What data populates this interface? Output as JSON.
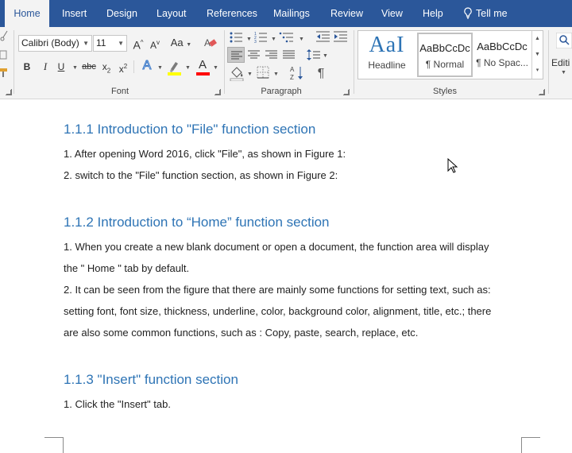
{
  "tabs": [
    {
      "label": "Home",
      "active": true
    },
    {
      "label": "Insert"
    },
    {
      "label": "Design"
    },
    {
      "label": "Layout"
    },
    {
      "label": "References"
    },
    {
      "label": "Mailings"
    },
    {
      "label": "Review"
    },
    {
      "label": "View"
    },
    {
      "label": "Help"
    },
    {
      "label": "Tell me",
      "icon": "lightbulb-icon"
    }
  ],
  "font_group": {
    "label": "Font",
    "font_name": "Calibri (Body)",
    "font_size": "11",
    "change_case": "Aa",
    "bold": "B",
    "italic": "I",
    "underline": "U",
    "strikethrough": "abc",
    "subscript": "x",
    "subscript_mark": "2",
    "superscript": "x",
    "superscript_mark": "2",
    "text_effects": "A",
    "font_color": "A",
    "grow_font": "A",
    "shrink_font": "A",
    "highlight_color": "#ffff00",
    "font_color_value": "#ff0000"
  },
  "paragraph_group": {
    "label": "Paragraph",
    "pilcrow": "¶"
  },
  "styles_group": {
    "label": "Styles",
    "styles": [
      {
        "preview": "AaI",
        "name": "Headline"
      },
      {
        "preview": "AaBbCcDc",
        "name": "¶ Normal",
        "selected": true
      },
      {
        "preview": "AaBbCcDc",
        "name": "¶ No Spac..."
      }
    ]
  },
  "editing_group": {
    "label": "Editi"
  },
  "document": {
    "blocks": [
      {
        "type": "heading",
        "text": "1.1.1 Introduction to \"File\" function section"
      },
      {
        "type": "para",
        "text": "1. After opening Word 2016, click \"File\", as shown in Figure 1:"
      },
      {
        "type": "para",
        "text": "2. switch to the \"File\" function section, as shown in Figure 2:"
      },
      {
        "type": "heading",
        "text": "1.1.2 Introduction to “Home” function section"
      },
      {
        "type": "para",
        "text": "1. When you create a new blank document or open a document, the function area will display"
      },
      {
        "type": "para",
        "text": "the \" Home \" tab by default."
      },
      {
        "type": "para",
        "text": "2. It can be seen from the figure that there are mainly some functions for setting text, such as:"
      },
      {
        "type": "para",
        "text": "setting font, font size, thickness, underline, color, background color, alignment, title, etc.; there"
      },
      {
        "type": "para",
        "text": "are also some common functions, such as : Copy, paste, search, replace, etc."
      },
      {
        "type": "heading",
        "text": "1.1.3 \"Insert\" function section"
      },
      {
        "type": "para",
        "text": "1. Click the \"Insert\" tab."
      }
    ]
  },
  "colors": {
    "tab_bar": "#2b579a",
    "heading": "#2e74b5",
    "ribbon": "#f3f3f3"
  }
}
